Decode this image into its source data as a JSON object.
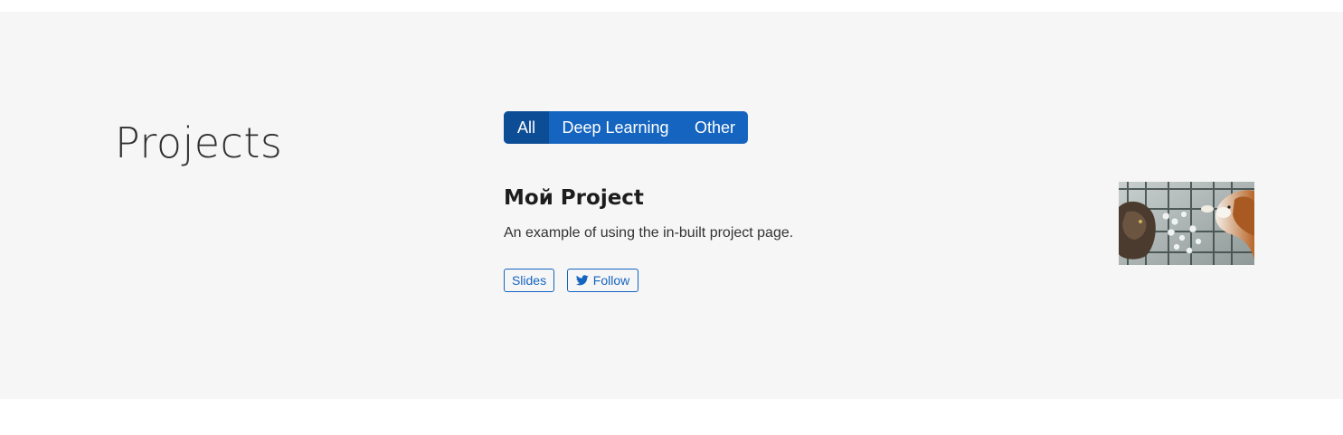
{
  "section": {
    "title": "Projects"
  },
  "filters": [
    {
      "label": "All",
      "active": true
    },
    {
      "label": "Deep Learning",
      "active": false
    },
    {
      "label": "Other",
      "active": false
    }
  ],
  "project": {
    "title": "Мой Project",
    "summary": "An example of using the in-built project page.",
    "links": {
      "slides_label": "Slides",
      "follow_label": "Follow",
      "follow_icon": "twitter-icon"
    },
    "image_alt": "cat-and-dog-playing-chess"
  },
  "colors": {
    "section_bg": "#f6f6f6",
    "primary": "#1565c0",
    "primary_active": "#0d4d96"
  }
}
